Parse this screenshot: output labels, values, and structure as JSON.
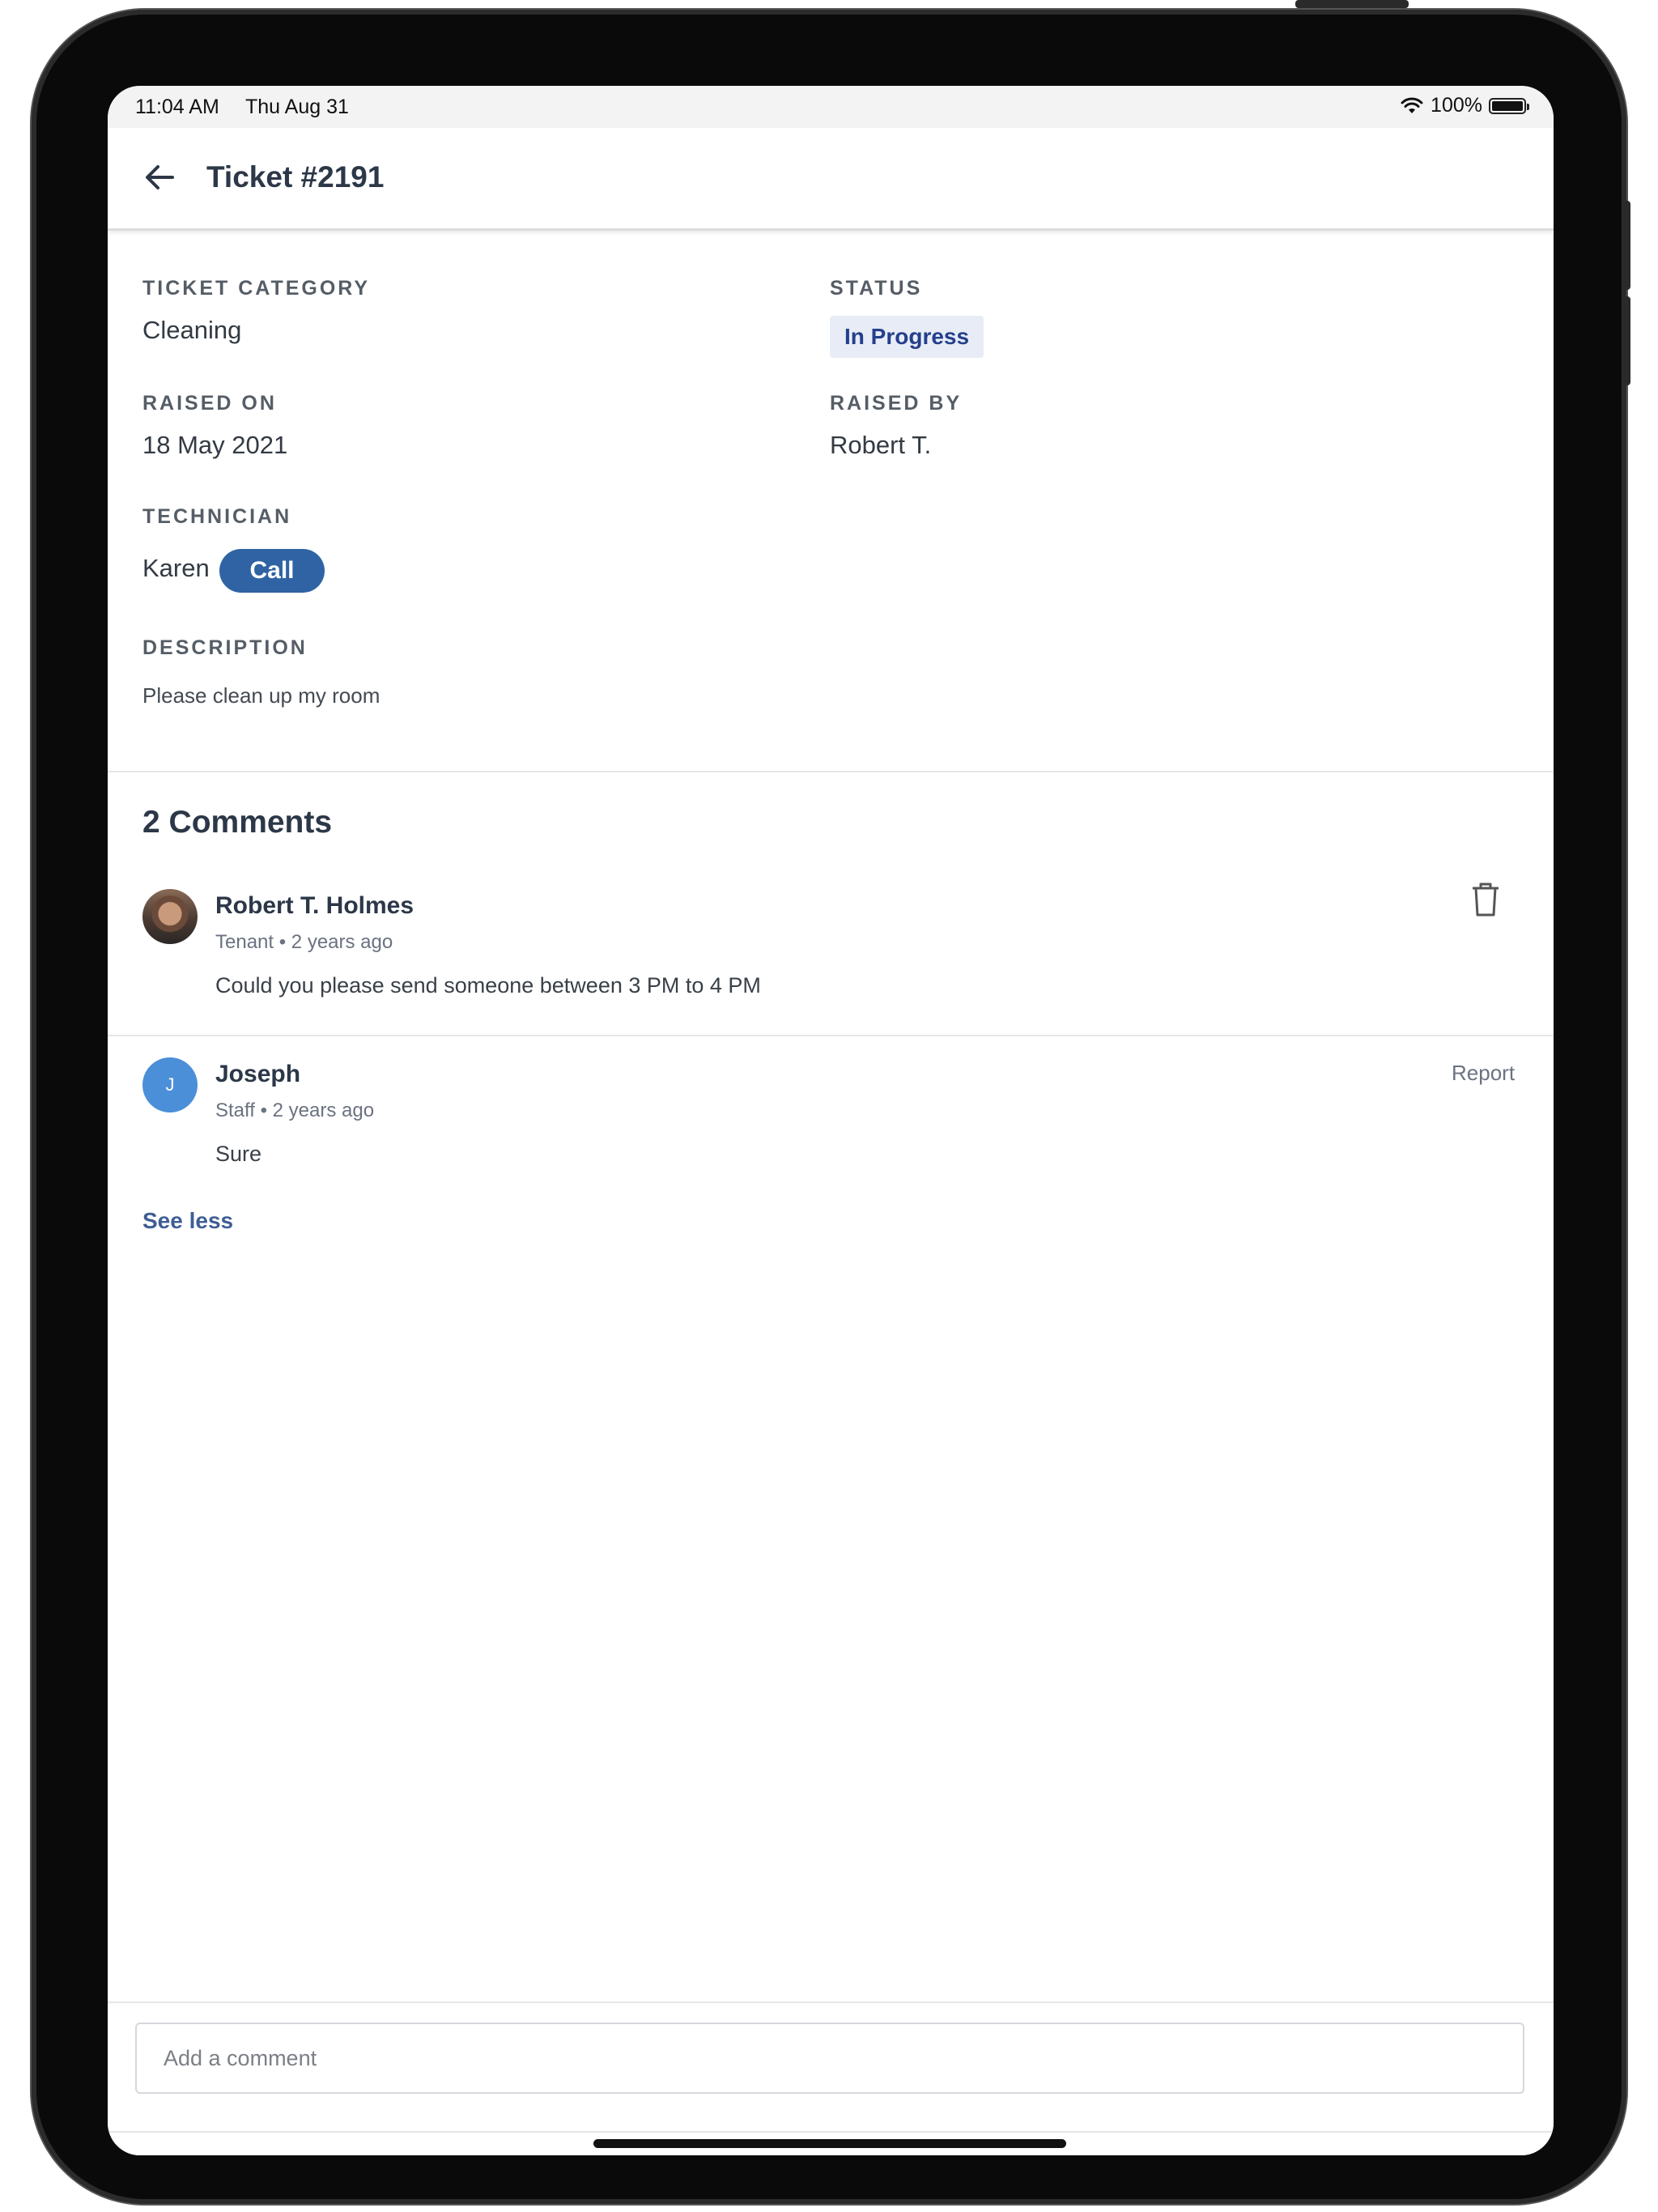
{
  "status_bar": {
    "time": "11:04 AM",
    "date": "Thu Aug 31",
    "battery": "100%"
  },
  "header": {
    "title": "Ticket #2191"
  },
  "ticket": {
    "category_label": "TICKET CATEGORY",
    "category_value": "Cleaning",
    "status_label": "STATUS",
    "status_value": "In Progress",
    "raised_on_label": "RAISED ON",
    "raised_on_value": "18 May 2021",
    "raised_by_label": "RAISED BY",
    "raised_by_value": "Robert T.",
    "technician_label": "TECHNICIAN",
    "technician_value": "Karen",
    "call_label": "Call",
    "description_label": "DESCRIPTION",
    "description_value": "Please clean up my room"
  },
  "comments": {
    "title": "2 Comments",
    "items": [
      {
        "name": "Robert T. Holmes",
        "meta": "Tenant • 2 years ago",
        "text": "Could you please send someone between 3 PM to 4 PM"
      },
      {
        "avatar_initial": "J",
        "name": "Joseph",
        "meta": "Staff • 2 years ago",
        "text": "Sure",
        "action": "Report"
      }
    ],
    "see_less": "See less"
  },
  "composer": {
    "placeholder": "Add a comment"
  },
  "colors": {
    "primary": "#2f63a3",
    "status_bg": "#e7ecf6",
    "status_text": "#243f8c",
    "avatar_j": "#4b8fd8",
    "link": "#3e5e94"
  }
}
